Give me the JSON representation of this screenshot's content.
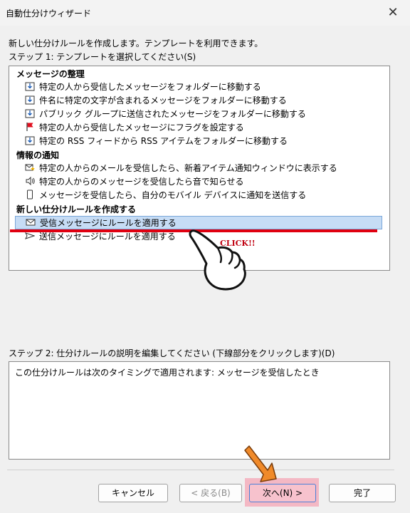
{
  "window": {
    "title": "自動仕分けウィザード",
    "close_label": "✕"
  },
  "intro": "新しい仕分けルールを作成します。テンプレートを利用できます。",
  "step1_label": "ステップ 1: テンプレートを選択してください(S)",
  "groups": [
    {
      "label": "メッセージの整理",
      "items": [
        {
          "label": "特定の人から受信したメッセージをフォルダーに移動する",
          "icon": "move-to-folder-icon"
        },
        {
          "label": "件名に特定の文字が含まれるメッセージをフォルダーに移動する",
          "icon": "move-to-folder-icon"
        },
        {
          "label": "パブリック グループに送信されたメッセージをフォルダーに移動する",
          "icon": "move-to-folder-icon"
        },
        {
          "label": "特定の人から受信したメッセージにフラグを設定する",
          "icon": "flag-icon"
        },
        {
          "label": "特定の RSS フィードから RSS アイテムをフォルダーに移動する",
          "icon": "move-to-folder-icon"
        }
      ]
    },
    {
      "label": "情報の通知",
      "items": [
        {
          "label": "特定の人からのメールを受信したら、新着アイテム通知ウィンドウに表示する",
          "icon": "new-item-alert-icon"
        },
        {
          "label": "特定の人からのメッセージを受信したら音で知らせる",
          "icon": "speaker-icon"
        },
        {
          "label": "メッセージを受信したら、自分のモバイル デバイスに通知を送信する",
          "icon": "mobile-device-icon"
        }
      ]
    },
    {
      "label": "新しい仕分けルールを作成する",
      "items": [
        {
          "label": "受信メッセージにルールを適用する",
          "icon": "envelope-icon",
          "selected": true
        },
        {
          "label": "送信メッセージにルールを適用する",
          "icon": "send-icon"
        }
      ]
    }
  ],
  "annotation": {
    "click_label": "CLICK!!",
    "accent": "#e00010",
    "arrow_color": "#f08a2a"
  },
  "step2_label": "ステップ 2: 仕分けルールの説明を編集してください (下線部分をクリックします)(D)",
  "description": "この仕分けルールは次のタイミングで適用されます: メッセージを受信したとき",
  "buttons": {
    "cancel": "キャンセル",
    "back": "< 戻る(B)",
    "next": "次へ(N) >",
    "finish": "完了"
  }
}
